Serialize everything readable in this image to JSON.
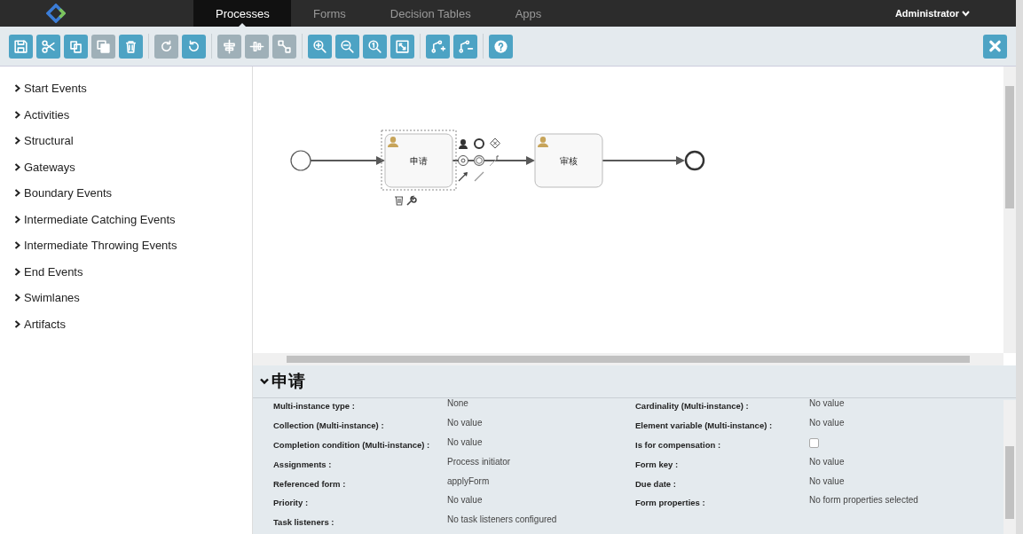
{
  "navbar": {
    "tabs": [
      {
        "label": "Processes",
        "selected": true
      },
      {
        "label": "Forms",
        "selected": false
      },
      {
        "label": "Decision Tables",
        "selected": false
      },
      {
        "label": "Apps",
        "selected": false
      }
    ],
    "user": "Administrator"
  },
  "toolbar": {
    "groups": [
      [
        {
          "kind": "save",
          "disabled": false
        },
        {
          "kind": "cut",
          "disabled": false
        },
        {
          "kind": "copy",
          "disabled": false
        },
        {
          "kind": "paste",
          "disabled": true
        },
        {
          "kind": "delete",
          "disabled": false
        }
      ],
      [
        {
          "kind": "redo",
          "disabled": true
        },
        {
          "kind": "undo",
          "disabled": false
        }
      ],
      [
        {
          "kind": "align-horizontal",
          "disabled": true
        },
        {
          "kind": "align-vertical",
          "disabled": true
        },
        {
          "kind": "same-size",
          "disabled": true
        }
      ],
      [
        {
          "kind": "zoom-in",
          "disabled": false
        },
        {
          "kind": "zoom-out",
          "disabled": false
        },
        {
          "kind": "zoom-actual",
          "disabled": false
        },
        {
          "kind": "zoom-fit",
          "disabled": false
        }
      ],
      [
        {
          "kind": "add-bendpoint",
          "disabled": false
        },
        {
          "kind": "remove-bendpoint",
          "disabled": false
        }
      ],
      [
        {
          "kind": "help",
          "disabled": false
        }
      ]
    ]
  },
  "palette": {
    "items": [
      {
        "label": "Start Events"
      },
      {
        "label": "Activities"
      },
      {
        "label": "Structural"
      },
      {
        "label": "Gateways"
      },
      {
        "label": "Boundary Events"
      },
      {
        "label": "Intermediate Catching Events"
      },
      {
        "label": "Intermediate Throwing Events"
      },
      {
        "label": "End Events"
      },
      {
        "label": "Swimlanes"
      },
      {
        "label": "Artifacts"
      }
    ]
  },
  "diagram": {
    "nodes": [
      {
        "kind": "start"
      },
      {
        "kind": "task",
        "label": "申请",
        "selected": true
      },
      {
        "kind": "task",
        "label": "审核",
        "selected": false
      },
      {
        "kind": "end"
      }
    ]
  },
  "properties": {
    "title": "申请",
    "expanded": true,
    "left": [
      {
        "label": "Multi-instance type :",
        "kind": "text",
        "value": "None"
      },
      {
        "label": "Collection (Multi-instance) :",
        "kind": "text",
        "value": "No value"
      },
      {
        "label": "Completion condition (Multi-instance) :",
        "kind": "text",
        "value": "No value"
      },
      {
        "label": "Assignments :",
        "kind": "text",
        "value": "Process initiator"
      },
      {
        "label": "Referenced form :",
        "kind": "text",
        "value": "applyForm"
      },
      {
        "label": "Priority :",
        "kind": "text",
        "value": "No value"
      },
      {
        "label": "Task listeners :",
        "kind": "text",
        "value": "No task listeners configured"
      }
    ],
    "right": [
      {
        "label": "Cardinality (Multi-instance) :",
        "kind": "text",
        "value": "No value"
      },
      {
        "label": "Element variable (Multi-instance) :",
        "kind": "text",
        "value": "No value"
      },
      {
        "label": "Is for compensation :",
        "kind": "checkbox",
        "checked": false
      },
      {
        "label": "Form key :",
        "kind": "text",
        "value": "No value"
      },
      {
        "label": "Due date :",
        "kind": "text",
        "value": "No value"
      },
      {
        "label": "Form properties :",
        "kind": "text",
        "value": "No form properties selected"
      }
    ]
  }
}
